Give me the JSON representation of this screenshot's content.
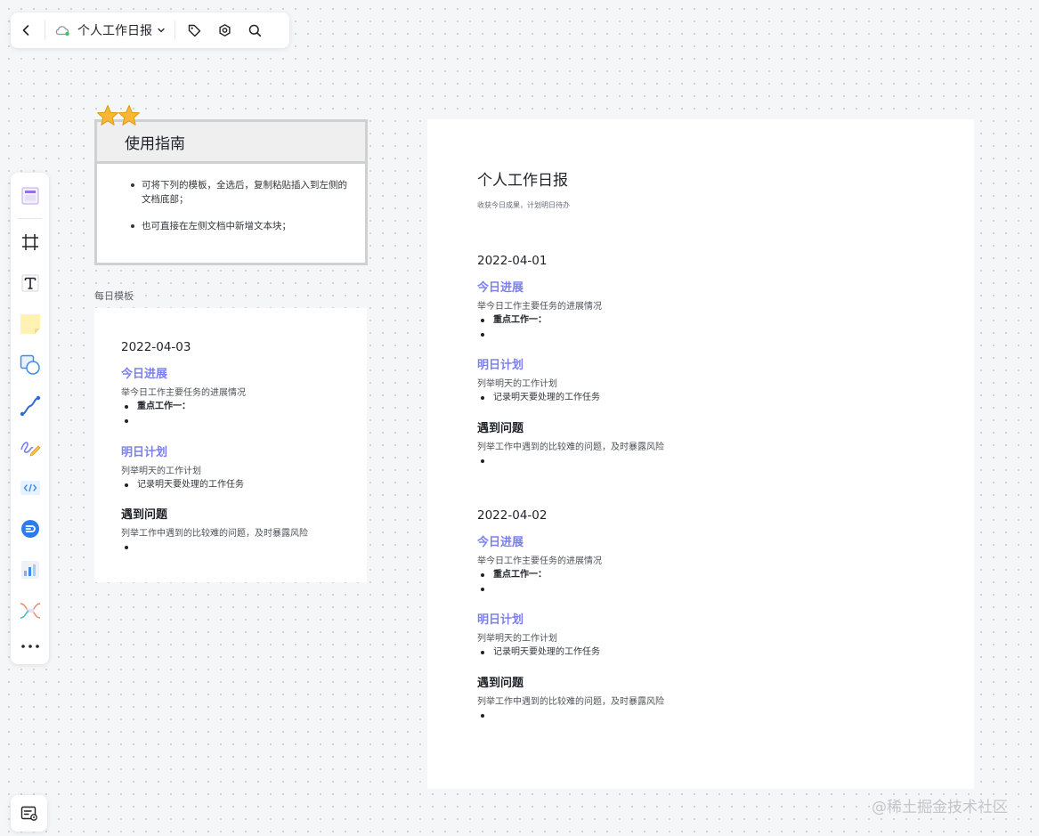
{
  "toolbar": {
    "title": "个人工作日报",
    "back_icon": "chevron-left-icon",
    "cloud_icon": "cloud-sync-icon",
    "tag_icon": "tag-icon",
    "settings_icon": "gear-icon",
    "search_icon": "search-icon"
  },
  "palette": {
    "items": [
      {
        "name": "template",
        "icon": "template-icon"
      },
      {
        "name": "frame",
        "icon": "frame-icon"
      },
      {
        "name": "text",
        "icon": "text-icon"
      },
      {
        "name": "sticky-note",
        "icon": "sticky-note-icon"
      },
      {
        "name": "shape",
        "icon": "shape-icon"
      },
      {
        "name": "connector",
        "icon": "connector-icon"
      },
      {
        "name": "pen",
        "icon": "pen-icon"
      },
      {
        "name": "code-block",
        "icon": "code-block-icon"
      },
      {
        "name": "embed",
        "icon": "embed-icon"
      },
      {
        "name": "chart",
        "icon": "chart-icon"
      },
      {
        "name": "mindmap",
        "icon": "mindmap-icon"
      },
      {
        "name": "more",
        "icon": "more-icon"
      }
    ]
  },
  "guide": {
    "title": "使用指南",
    "items": [
      "可将下列的模板，全选后，复制粘贴插入到左侧的文档底部；",
      "也可直接在左侧文档中新增文本块；"
    ]
  },
  "template_label": "每日模板",
  "template_card": {
    "date": "2022-04-03",
    "progress_title": "今日进展",
    "progress_desc": "举今日工作主要任务的进展情况",
    "progress_bullets": [
      "重点工作一：",
      ""
    ],
    "plan_title": "明日计划",
    "plan_desc": "列举明天的工作计划",
    "plan_bullets": [
      "记录明天要处理的工作任务"
    ],
    "issue_title": "遇到问题",
    "issue_desc": "列举工作中遇到的比较难的问题，及时暴露风险",
    "issue_bullets": [
      ""
    ]
  },
  "doc": {
    "title": "个人工作日报",
    "subtitle": "收获今日成果，计划明日待办",
    "days": [
      {
        "date": "2022-04-01",
        "progress_title": "今日进展",
        "progress_desc": "举今日工作主要任务的进展情况",
        "progress_bullets": [
          "重点工作一：",
          ""
        ],
        "plan_title": "明日计划",
        "plan_desc": "列举明天的工作计划",
        "plan_bullets": [
          "记录明天要处理的工作任务"
        ],
        "issue_title": "遇到问题",
        "issue_desc": "列举工作中遇到的比较难的问题，及时暴露风险",
        "issue_bullets": [
          ""
        ]
      },
      {
        "date": "2022-04-02",
        "progress_title": "今日进展",
        "progress_desc": "举今日工作主要任务的进展情况",
        "progress_bullets": [
          "重点工作一：",
          ""
        ],
        "plan_title": "明日计划",
        "plan_desc": "列举明天的工作计划",
        "plan_bullets": [
          "记录明天要处理的工作任务"
        ],
        "issue_title": "遇到问题",
        "issue_desc": "列举工作中遇到的比较难的问题，及时暴露风险",
        "issue_bullets": [
          ""
        ]
      }
    ]
  },
  "bottom_button_icon": "board-info-icon",
  "watermark": "@稀土掘金技术社区",
  "colors": {
    "accent": "#7b7ff0",
    "canvas": "#f5f6f8"
  }
}
